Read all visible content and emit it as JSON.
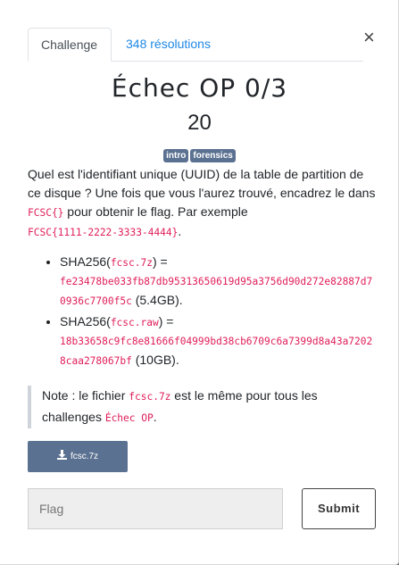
{
  "tabs": [
    {
      "label": "Challenge",
      "active": true
    },
    {
      "label": "348 résolutions",
      "active": false
    }
  ],
  "close_label": "×",
  "challenge": {
    "title": "Échec OP 0/3",
    "points": "20",
    "tags": [
      "intro",
      "forensics"
    ]
  },
  "description": {
    "line1": "Quel est l'identifiant unique (UUID) de la table de partition de ce disque ? Une fois que vous l'aurez trouvé, encadrez le dans ",
    "flag_format": "FCSC{}",
    "line2": " pour obtenir le flag. Par exemple",
    "example": "FCSC{1111-2222-3333-4444}",
    "example_suffix": "."
  },
  "files": [
    {
      "prefix": "SHA256(",
      "name": "fcsc.7z",
      "suffix": ") =",
      "hash": "fe23478be033fb87db95313650619d95a3756d90d272e82887d70936c7700f5c",
      "size": " (5.4GB)."
    },
    {
      "prefix": "SHA256(",
      "name": "fcsc.raw",
      "suffix": ") =",
      "hash": "18b33658c9fc8e81666f04999bd38cb6709c6a7399d8a43a72028caa278067bf",
      "size": " (10GB)."
    }
  ],
  "note": {
    "prefix": "Note : le fichier ",
    "file": "fcsc.7z",
    "middle": " est le même pour tous les challenges ",
    "series": "Échec OP",
    "suffix": "."
  },
  "download": {
    "label": "fcsc.7z",
    "icon": "download-icon"
  },
  "flag_input": {
    "placeholder": "Flag",
    "value": ""
  },
  "submit_label": "Submit",
  "colors": {
    "badge": "#5b7191",
    "link": "#1e88e5",
    "code": "#e01e5a",
    "button": "#5b7191"
  }
}
